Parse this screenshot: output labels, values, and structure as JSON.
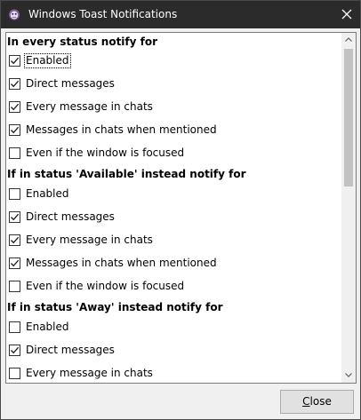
{
  "window": {
    "title": "Windows Toast Notifications",
    "titlebar_color": "#2b2b2b"
  },
  "sections": [
    {
      "header": "In every status notify for",
      "items": [
        {
          "label": "Enabled",
          "checked": true,
          "focused": true
        },
        {
          "label": "Direct messages",
          "checked": true
        },
        {
          "label": "Every message in chats",
          "checked": true
        },
        {
          "label": "Messages in chats when mentioned",
          "checked": true
        },
        {
          "label": "Even if the window is focused",
          "checked": false
        }
      ]
    },
    {
      "header": "If in status 'Available' instead notify for",
      "items": [
        {
          "label": "Enabled",
          "checked": false
        },
        {
          "label": "Direct messages",
          "checked": true
        },
        {
          "label": "Every message in chats",
          "checked": true
        },
        {
          "label": "Messages in chats when mentioned",
          "checked": true
        },
        {
          "label": "Even if the window is focused",
          "checked": false
        }
      ]
    },
    {
      "header": "If in status 'Away' instead notify for",
      "items": [
        {
          "label": "Enabled",
          "checked": false
        },
        {
          "label": "Direct messages",
          "checked": true
        },
        {
          "label": "Every message in chats",
          "checked": false
        }
      ]
    }
  ],
  "footer": {
    "close_label_mnemonic": "C",
    "close_label_rest": "lose"
  },
  "icons": {
    "app": "pidgin-purple-icon",
    "close": "close-x-icon",
    "check": "checkmark-icon"
  }
}
